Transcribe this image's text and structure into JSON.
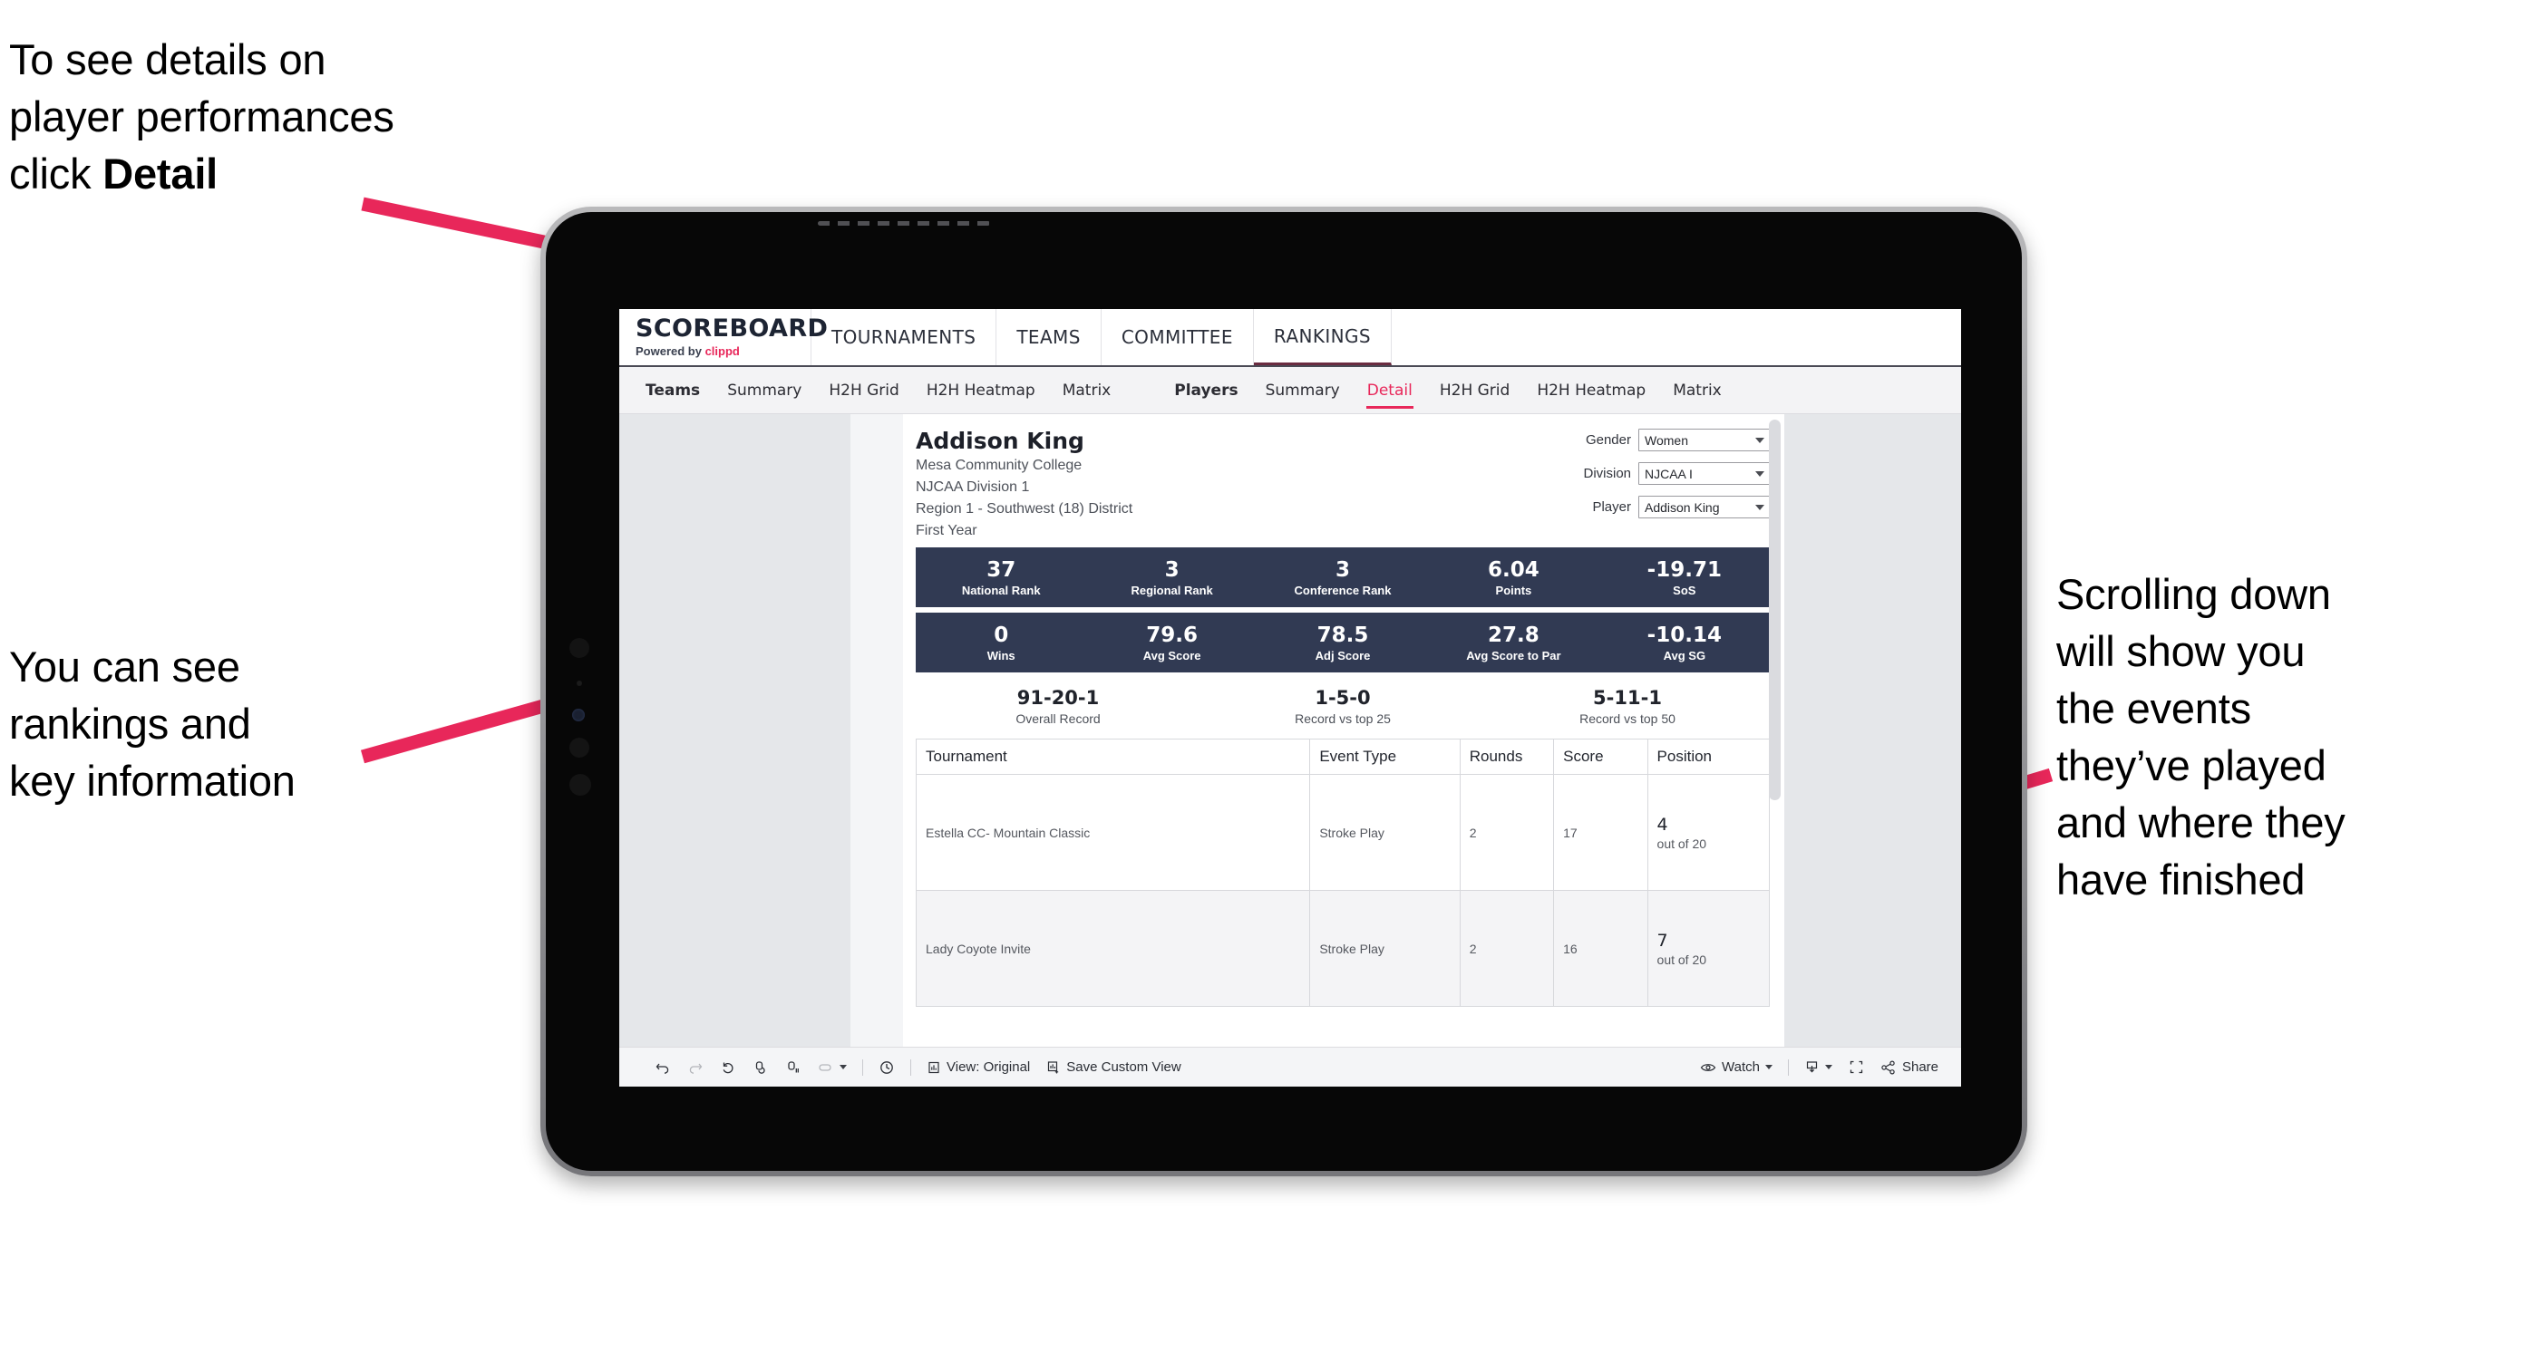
{
  "annotations": {
    "top_left": {
      "line1": "To see details on",
      "line2": "player performances",
      "line3_prefix": "click ",
      "line3_bold": "Detail"
    },
    "mid_left": {
      "line1": "You can see",
      "line2": "rankings and",
      "line3": "key information"
    },
    "right": {
      "line1": "Scrolling down",
      "line2": "will show you",
      "line3": "the events",
      "line4": "they’ve played",
      "line5": "and where they",
      "line6": "have finished"
    }
  },
  "browser": {
    "brand": {
      "title": "SCOREBOARD",
      "sub_prefix": "Powered by ",
      "sub_brand": "clippd"
    },
    "top_nav": [
      {
        "label": "TOURNAMENTS",
        "active": false
      },
      {
        "label": "TEAMS",
        "active": false
      },
      {
        "label": "COMMITTEE",
        "active": false
      },
      {
        "label": "RANKINGS",
        "active": true
      }
    ],
    "tab_groups": [
      {
        "lead": "Teams",
        "tabs": [
          "Summary",
          "H2H Grid",
          "H2H Heatmap",
          "Matrix"
        ],
        "active": ""
      },
      {
        "lead": "Players",
        "tabs": [
          "Summary",
          "Detail",
          "H2H Grid",
          "H2H Heatmap",
          "Matrix"
        ],
        "active": "Detail"
      }
    ]
  },
  "player": {
    "name": "Addison King",
    "school": "Mesa Community College",
    "division": "NJCAA Division 1",
    "region": "Region 1 - Southwest (18) District",
    "class_year": "First Year"
  },
  "filters": [
    {
      "label": "Gender",
      "value": "Women"
    },
    {
      "label": "Division",
      "value": "NJCAA I"
    },
    {
      "label": "Player",
      "value": "Addison King"
    }
  ],
  "kpi_rows": [
    [
      {
        "value": "37",
        "label": "National Rank"
      },
      {
        "value": "3",
        "label": "Regional Rank"
      },
      {
        "value": "3",
        "label": "Conference Rank"
      },
      {
        "value": "6.04",
        "label": "Points"
      },
      {
        "value": "-19.71",
        "label": "SoS"
      }
    ],
    [
      {
        "value": "0",
        "label": "Wins"
      },
      {
        "value": "79.6",
        "label": "Avg Score"
      },
      {
        "value": "78.5",
        "label": "Adj Score"
      },
      {
        "value": "27.8",
        "label": "Avg Score to Par"
      },
      {
        "value": "-10.14",
        "label": "Avg SG"
      }
    ]
  ],
  "records": [
    {
      "value": "91-20-1",
      "label": "Overall Record"
    },
    {
      "value": "1-5-0",
      "label": "Record vs top 25"
    },
    {
      "value": "5-11-1",
      "label": "Record vs top 50"
    }
  ],
  "table": {
    "columns": [
      "Tournament",
      "Event Type",
      "Rounds",
      "Score",
      "Position"
    ],
    "rows": [
      {
        "tournament": "Estella CC- Mountain Classic",
        "event_type": "Stroke Play",
        "rounds": "2",
        "score": "17",
        "position": "4",
        "position_sub": "out of 20"
      },
      {
        "tournament": "Lady Coyote Invite",
        "event_type": "Stroke Play",
        "rounds": "2",
        "score": "16",
        "position": "7",
        "position_sub": "out of 20"
      }
    ]
  },
  "toolbar": {
    "view_label": "View: Original",
    "save_view_label": "Save Custom View",
    "watch_label": "Watch",
    "share_label": "Share"
  },
  "colors": {
    "accent_pink": "#e8275a",
    "kpi_navy": "#313a53",
    "page_bg": "#e5e7ea"
  }
}
